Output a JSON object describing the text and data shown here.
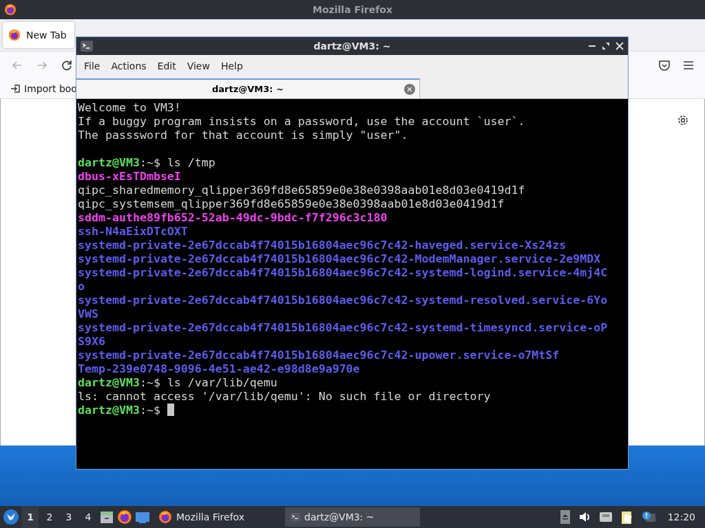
{
  "browser": {
    "title": "Mozilla Firefox",
    "tabs": [
      {
        "label": "New Tab",
        "selected": true
      }
    ],
    "bookmarks": [
      {
        "label": "Import boo"
      }
    ]
  },
  "terminal": {
    "title": "dartz@VM3: ~",
    "menu": [
      "File",
      "Actions",
      "Edit",
      "View",
      "Help"
    ],
    "tabs": [
      {
        "label": "dartz@VM3: ~",
        "selected": true
      }
    ],
    "lines": [
      {
        "kind": "output",
        "text": "Welcome to VM3!",
        "color": "#d3d7cf",
        "bold": false
      },
      {
        "kind": "output",
        "text": "If a buggy program insists on a password, use the account `user`.",
        "color": "#d3d7cf",
        "bold": false
      },
      {
        "kind": "output",
        "text": "The passsword for that account is simply \"user\".",
        "color": "#d3d7cf",
        "bold": false
      },
      {
        "kind": "blank"
      },
      {
        "kind": "prompt",
        "user": "dartz@VM3",
        "rest": ":~$ ls /tmp",
        "cursor": false
      },
      {
        "kind": "output",
        "text": "dbus-xEsTDmbseI",
        "color": "#f040f0",
        "bold": true
      },
      {
        "kind": "output",
        "text": "qipc_sharedmemory_qlipper369fd8e65859e0e38e0398aab01e8d03e0419d1f",
        "color": "#d3d7cf",
        "bold": false
      },
      {
        "kind": "output",
        "text": "qipc_systemsem_qlipper369fd8e65859e0e38e0398aab01e8d03e0419d1f",
        "color": "#d3d7cf",
        "bold": false
      },
      {
        "kind": "output",
        "text": "sddm-authe89fb652-52ab-49dc-9bdc-f7f296c3c180",
        "color": "#f040f0",
        "bold": true
      },
      {
        "kind": "output",
        "text": "ssh-N4aEixDTcOXT",
        "color": "#5c5cf0",
        "bold": true
      },
      {
        "kind": "output",
        "text": "systemd-private-2e67dccab4f74015b16804aec96c7c42-haveged.service-Xs24zs",
        "color": "#5c5cf0",
        "bold": true
      },
      {
        "kind": "output",
        "text": "systemd-private-2e67dccab4f74015b16804aec96c7c42-ModemManager.service-2e9MDX",
        "color": "#5c5cf0",
        "bold": true
      },
      {
        "kind": "output",
        "text": "systemd-private-2e67dccab4f74015b16804aec96c7c42-systemd-logind.service-4mj4Co",
        "color": "#5c5cf0",
        "bold": true
      },
      {
        "kind": "output",
        "text": "systemd-private-2e67dccab4f74015b16804aec96c7c42-systemd-resolved.service-6YoVWS",
        "color": "#5c5cf0",
        "bold": true
      },
      {
        "kind": "output",
        "text": "systemd-private-2e67dccab4f74015b16804aec96c7c42-systemd-timesyncd.service-oPS9X6",
        "color": "#5c5cf0",
        "bold": true
      },
      {
        "kind": "output",
        "text": "systemd-private-2e67dccab4f74015b16804aec96c7c42-upower.service-o7MtSf",
        "color": "#5c5cf0",
        "bold": true
      },
      {
        "kind": "output",
        "text": "Temp-239e0748-9096-4e51-ae42-e98d8e9a970e",
        "color": "#5c5cf0",
        "bold": true
      },
      {
        "kind": "prompt",
        "user": "dartz@VM3",
        "rest": ":~$ ls /var/lib/qemu",
        "cursor": false
      },
      {
        "kind": "output",
        "text": "ls: cannot access '/var/lib/qemu': No such file or directory",
        "color": "#d3d7cf",
        "bold": false
      },
      {
        "kind": "prompt",
        "user": "dartz@VM3",
        "rest": ":~$ ",
        "cursor": true
      }
    ]
  },
  "taskbar": {
    "workspaces": [
      {
        "label": "1",
        "selected": true
      },
      {
        "label": "2",
        "selected": false
      },
      {
        "label": "3",
        "selected": false
      },
      {
        "label": "4",
        "selected": false
      }
    ],
    "tasks": [
      {
        "label": "Mozilla Firefox",
        "kind": "browser",
        "selected": false
      },
      {
        "label": "dartz@VM3: ~",
        "kind": "terminal",
        "selected": true
      }
    ],
    "clock": "12:20"
  }
}
